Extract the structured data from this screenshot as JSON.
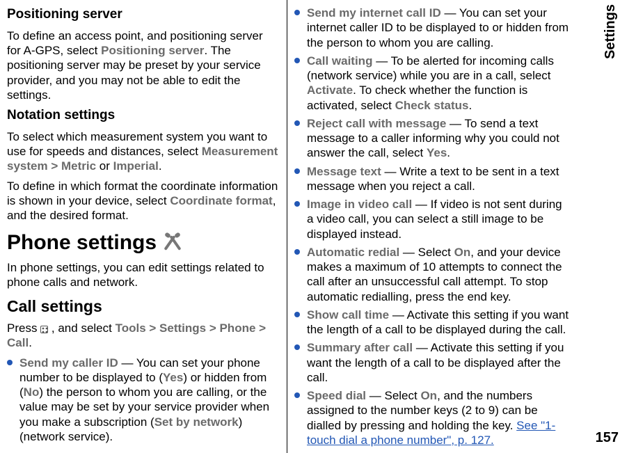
{
  "sideTab": "Settings",
  "pageNumber": "157",
  "left": {
    "h_positioning": "Positioning server",
    "p_positioning_a": "To define an access point, and positioning server for A-GPS, select ",
    "g_positioning_server": "Positioning server",
    "p_positioning_b": ". The positioning server may be preset by your service provider, and you may not be able to edit the settings.",
    "h_notation": "Notation settings",
    "p_notation_a": "To select which measurement system you want to use for speeds and distances, select ",
    "g_measurement_system": "Measurement system",
    "gt1": " > ",
    "g_metric": "Metric",
    "or": " or ",
    "g_imperial": "Imperial",
    "period1": ".",
    "p_coord_a": "To define in which format the coordinate information is shown in your device, select ",
    "g_coord_format": "Coordinate format",
    "p_coord_b": ", and the desired format.",
    "h_phone_settings": "Phone settings",
    "p_phone_intro": "In phone settings, you can edit settings related to phone calls and network.",
    "h_call_settings": "Call settings",
    "p_call_a": "Press ",
    "p_call_b": " , and select ",
    "g_tools": "Tools",
    "gt2": " > ",
    "g_settings": "Settings",
    "gt3": " > ",
    "g_phone": "Phone",
    "gt4": " > ",
    "g_call": "Call",
    "period2": ".",
    "li1_g": "Send my caller ID",
    "li1_a": "  — You can set your phone number to be displayed to (",
    "li1_yes": "Yes",
    "li1_b": ") or hidden from (",
    "li1_no": "No",
    "li1_c": ") the person to whom you are calling, or the value may be set by your service provider when you make a subscription (",
    "li1_set": "Set by network",
    "li1_d": ") (network service)."
  },
  "right": {
    "li2_g": "Send my internet call ID",
    "li2_a": "  — You can set your internet caller ID to be displayed to or hidden from the person to whom you are calling.",
    "li3_g": "Call waiting",
    "li3_a": "  — To be alerted for incoming calls (network service) while you are in a call, select ",
    "li3_activate": "Activate",
    "li3_b": ". To check whether the function is activated, select ",
    "li3_check": "Check status",
    "li3_c": ".",
    "li4_g": "Reject call with message",
    "li4_a": "  — To send a text message to a caller informing why you could not answer the call, select ",
    "li4_yes": "Yes",
    "li4_b": ".",
    "li5_g": "Message text",
    "li5_a": "  — Write a text to be sent in a text message when you reject a call.",
    "li6_g": "Image in video call",
    "li6_a": "  — If video is not sent during a video call, you can select a still image to be displayed instead.",
    "li7_g": "Automatic redial",
    "li7_a": "  — Select ",
    "li7_on": "On",
    "li7_b": ", and your device makes a maximum of 10 attempts to connect the call after an unsuccessful call attempt. To stop automatic redialling, press the end key.",
    "li8_g": "Show call time",
    "li8_a": "  — Activate this setting if you want the length of a call to be displayed during the call.",
    "li9_g": "Summary after call",
    "li9_a": "  — Activate this setting if you want the length of a call to be displayed after the call.",
    "li10_g": "Speed dial",
    "li10_a": "  — Select ",
    "li10_on": "On",
    "li10_b": ", and the numbers assigned to the number keys (2 to 9) can be dialled by pressing and holding the key. ",
    "li10_link": "See \"1-touch dial a phone number\", p. 127."
  }
}
